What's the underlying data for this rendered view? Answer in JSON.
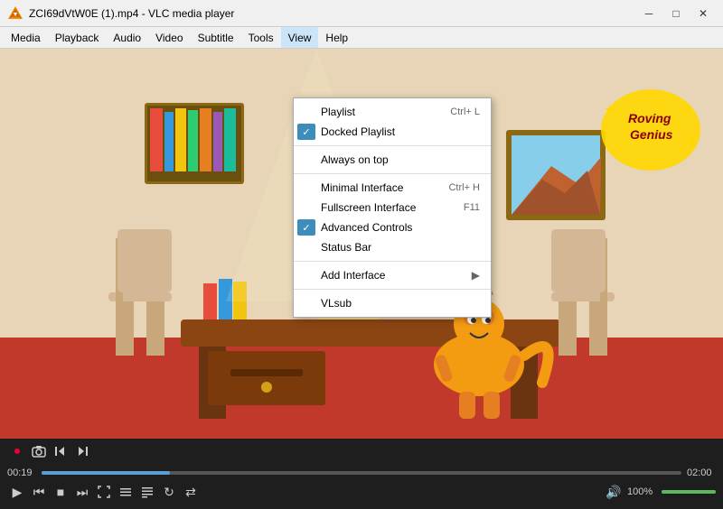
{
  "titlebar": {
    "title": "ZCI69dVtW0E (1).mp4 - VLC media player",
    "minimize": "─",
    "maximize": "□",
    "close": "✕"
  },
  "menubar": {
    "items": [
      "Media",
      "Playback",
      "Audio",
      "Video",
      "Subtitle",
      "Tools",
      "View",
      "Help"
    ]
  },
  "view_menu": {
    "items": [
      {
        "id": "playlist",
        "label": "Playlist",
        "shortcut": "Ctrl+ L",
        "checked": false,
        "has_check_bg": false
      },
      {
        "id": "docked-playlist",
        "label": "Docked Playlist",
        "shortcut": "",
        "checked": true,
        "has_check_bg": true
      },
      {
        "id": "sep1",
        "separator": true
      },
      {
        "id": "always-on-top",
        "label": "Always on top",
        "shortcut": "",
        "checked": false,
        "has_check_bg": false
      },
      {
        "id": "sep2",
        "separator": true
      },
      {
        "id": "minimal-interface",
        "label": "Minimal Interface",
        "shortcut": "Ctrl+ H",
        "checked": false,
        "has_check_bg": false
      },
      {
        "id": "fullscreen-interface",
        "label": "Fullscreen Interface",
        "shortcut": "F11",
        "checked": false,
        "has_check_bg": false
      },
      {
        "id": "advanced-controls",
        "label": "Advanced Controls",
        "shortcut": "",
        "checked": true,
        "has_check_bg": true
      },
      {
        "id": "status-bar",
        "label": "Status Bar",
        "shortcut": "",
        "checked": false,
        "has_check_bg": false
      },
      {
        "id": "sep3",
        "separator": true
      },
      {
        "id": "add-interface",
        "label": "Add Interface",
        "shortcut": "",
        "checked": false,
        "has_check_bg": false,
        "has_arrow": true
      },
      {
        "id": "sep4",
        "separator": true
      },
      {
        "id": "vlsub",
        "label": "VLsub",
        "shortcut": "",
        "checked": false,
        "has_check_bg": false
      }
    ]
  },
  "player": {
    "current_time": "00:19",
    "total_time": "02:00",
    "progress_pct": 20,
    "volume_pct": 100,
    "volume_label": "100%"
  },
  "controls": {
    "record": "⏺",
    "screenshot": "📷",
    "frame_by_frame_back": "⏮",
    "frame_by_frame": "⏭",
    "play": "▶",
    "prev": "⏮",
    "stop": "■",
    "next": "⏭",
    "fullscreen": "⛶",
    "extended": "≡",
    "playlist_ctrl": "≡",
    "loop": "↻",
    "shuffle": "⇄",
    "volume_icon": "🔊"
  }
}
